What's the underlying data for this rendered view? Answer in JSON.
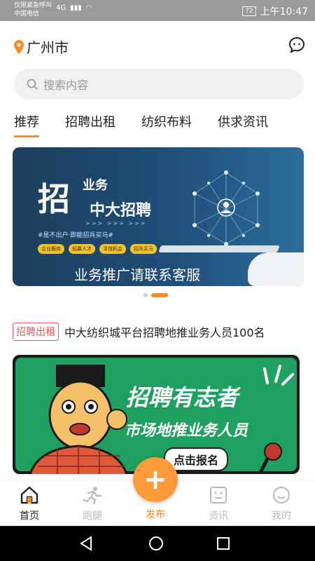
{
  "status": {
    "carrier_line1": "仅限紧急呼叫",
    "carrier_line2": "中国电信",
    "network": "4G",
    "battery": "72",
    "time": "上午10:47"
  },
  "header": {
    "city": "广州市"
  },
  "search": {
    "placeholder": "搜索内容"
  },
  "tabs": [
    {
      "label": "推荐",
      "active": true
    },
    {
      "label": "招聘出租"
    },
    {
      "label": "纺织布料"
    },
    {
      "label": "供求资讯"
    }
  ],
  "banner": {
    "big_char": "招",
    "line1": "业务",
    "line2": "中大招聘",
    "slogan": "#是不出户·即能招兵买马#",
    "tags": [
      "企业服务",
      "招募人才",
      "寻找机会",
      "招兵买马"
    ],
    "bottom_text": "业务推广请联系客服"
  },
  "news": {
    "tag": "招聘出租",
    "title": "中大纺织城平台招聘地推业务人员100名"
  },
  "promo": {
    "title": "招聘有志者",
    "subtitle": "市场地推业务人员",
    "button": "点击报名"
  },
  "nav": {
    "home": "首页",
    "errand": "跑腿",
    "publish": "发布",
    "news": "资讯",
    "mine": "我的"
  },
  "colors": {
    "accent": "#ff8a22",
    "tag_red": "#e05a5a",
    "promo_green": "#1fa060"
  }
}
